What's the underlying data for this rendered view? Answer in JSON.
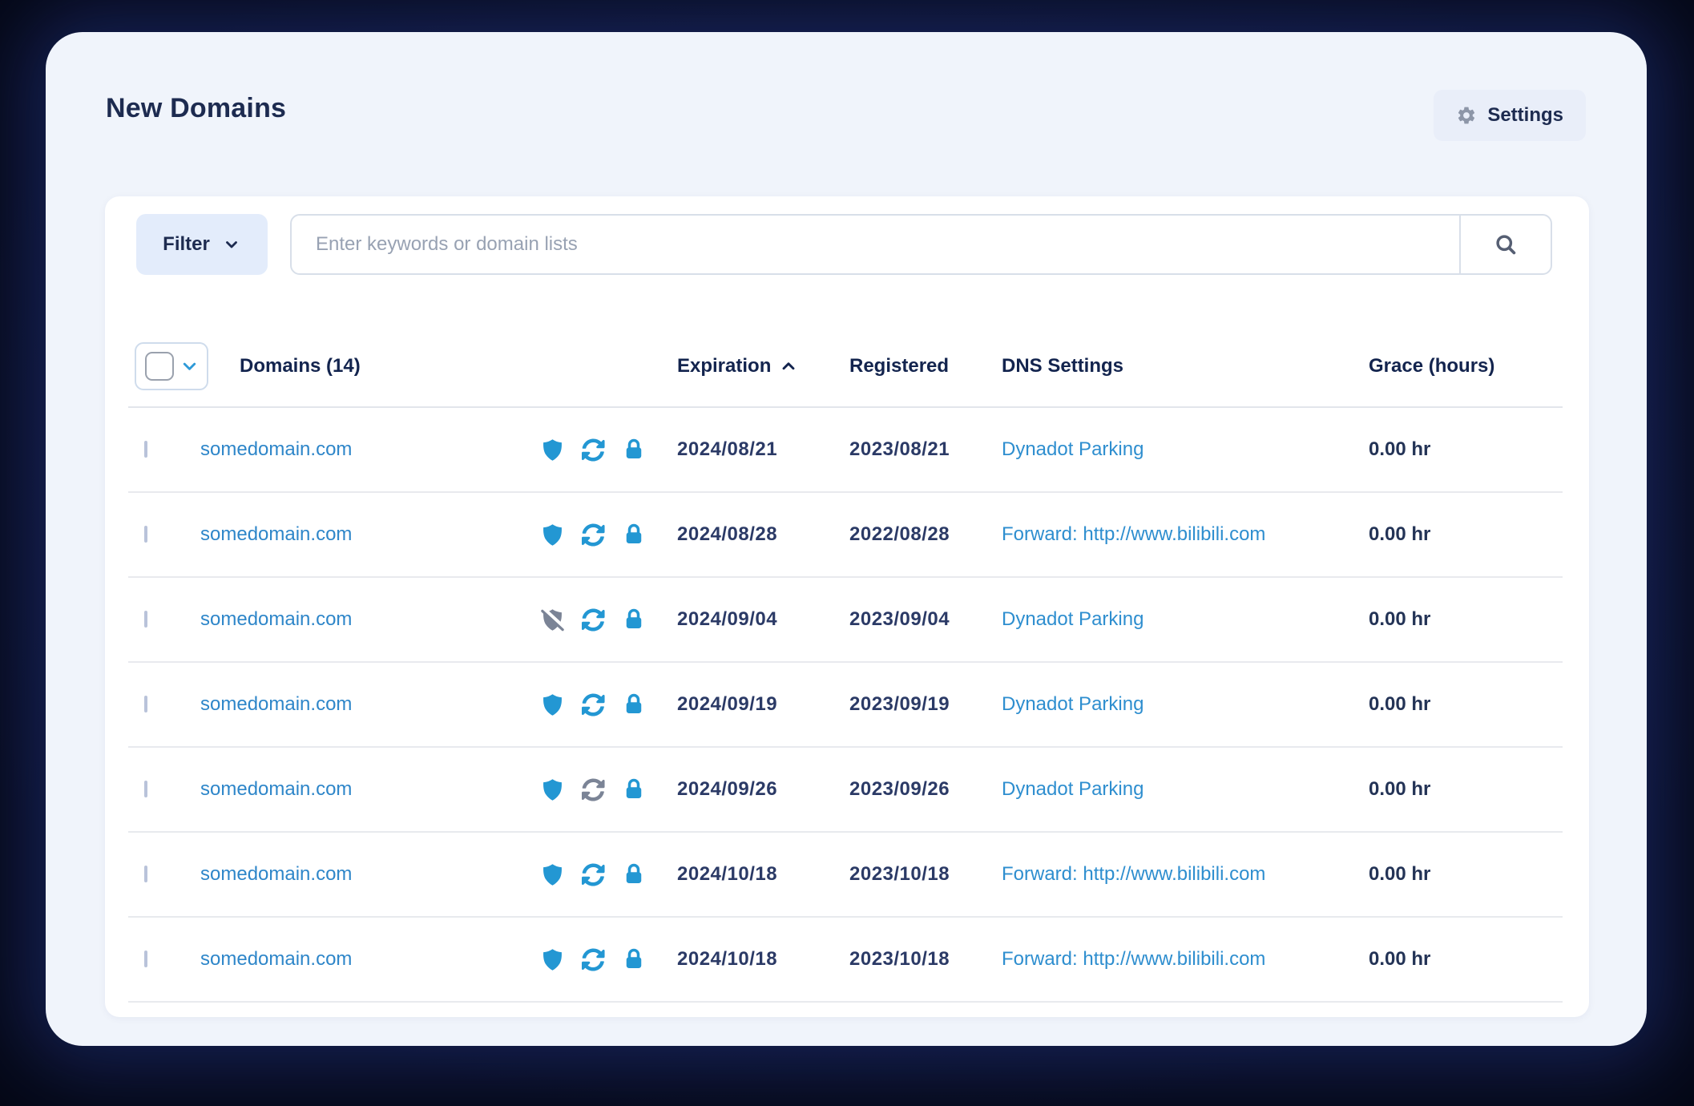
{
  "colors": {
    "outer_background": "#070b1d",
    "panel_background": "#f0f4fb",
    "card_background": "#ffffff",
    "accent_icon_blue": "#2397d3",
    "link_blue": "#2e86c9",
    "dns_link_blue": "#2e8ecf",
    "navy_text": "#1d2b50",
    "disabled_icon_gray": "#7b8496",
    "button_light_blue": "#e3ecfb"
  },
  "icons": {
    "settings": "gear-icon",
    "filter": "chevron-down-icon",
    "search": "magnifier-icon",
    "select_all": "chevron-down-icon",
    "sort_expiration": "chevron-up-icon",
    "privacy": "shield-icon",
    "auto_renew": "sync-icon",
    "lock": "lock-icon"
  },
  "header": {
    "title": "New Domains",
    "settings_button": "Settings"
  },
  "toolbar": {
    "filter_button": "Filter",
    "search_placeholder": "Enter keywords or domain lists",
    "search_value": ""
  },
  "table": {
    "columns": {
      "domains": "Domains (14)",
      "expiration": "Expiration",
      "registered": "Registered",
      "dns_settings": "DNS Settings",
      "grace": "Grace (hours)"
    },
    "rows": [
      {
        "domain": "somedomain.com",
        "privacy": "on",
        "auto_renew": "on",
        "lock": "on",
        "expiration": "2024/08/21",
        "registered": "2023/08/21",
        "dns": "Dynadot Parking",
        "grace": "0.00 hr"
      },
      {
        "domain": "somedomain.com",
        "privacy": "on",
        "auto_renew": "on",
        "lock": "on",
        "expiration": "2024/08/28",
        "registered": "2022/08/28",
        "dns": "Forward: http://www.bilibili.com",
        "grace": "0.00 hr"
      },
      {
        "domain": "somedomain.com",
        "privacy": "off",
        "auto_renew": "on",
        "lock": "on",
        "expiration": "2024/09/04",
        "registered": "2023/09/04",
        "dns": "Dynadot Parking",
        "grace": "0.00 hr"
      },
      {
        "domain": "somedomain.com",
        "privacy": "on",
        "auto_renew": "on",
        "lock": "on",
        "expiration": "2024/09/19",
        "registered": "2023/09/19",
        "dns": "Dynadot Parking",
        "grace": "0.00 hr"
      },
      {
        "domain": "somedomain.com",
        "privacy": "on",
        "auto_renew": "off",
        "lock": "on",
        "expiration": "2024/09/26",
        "registered": "2023/09/26",
        "dns": "Dynadot Parking",
        "grace": "0.00 hr"
      },
      {
        "domain": "somedomain.com",
        "privacy": "on",
        "auto_renew": "on",
        "lock": "on",
        "expiration": "2024/10/18",
        "registered": "2023/10/18",
        "dns": "Forward: http://www.bilibili.com",
        "grace": "0.00 hr"
      },
      {
        "domain": "somedomain.com",
        "privacy": "on",
        "auto_renew": "on",
        "lock": "on",
        "expiration": "2024/10/18",
        "registered": "2023/10/18",
        "dns": "Forward: http://www.bilibili.com",
        "grace": "0.00 hr"
      }
    ]
  }
}
